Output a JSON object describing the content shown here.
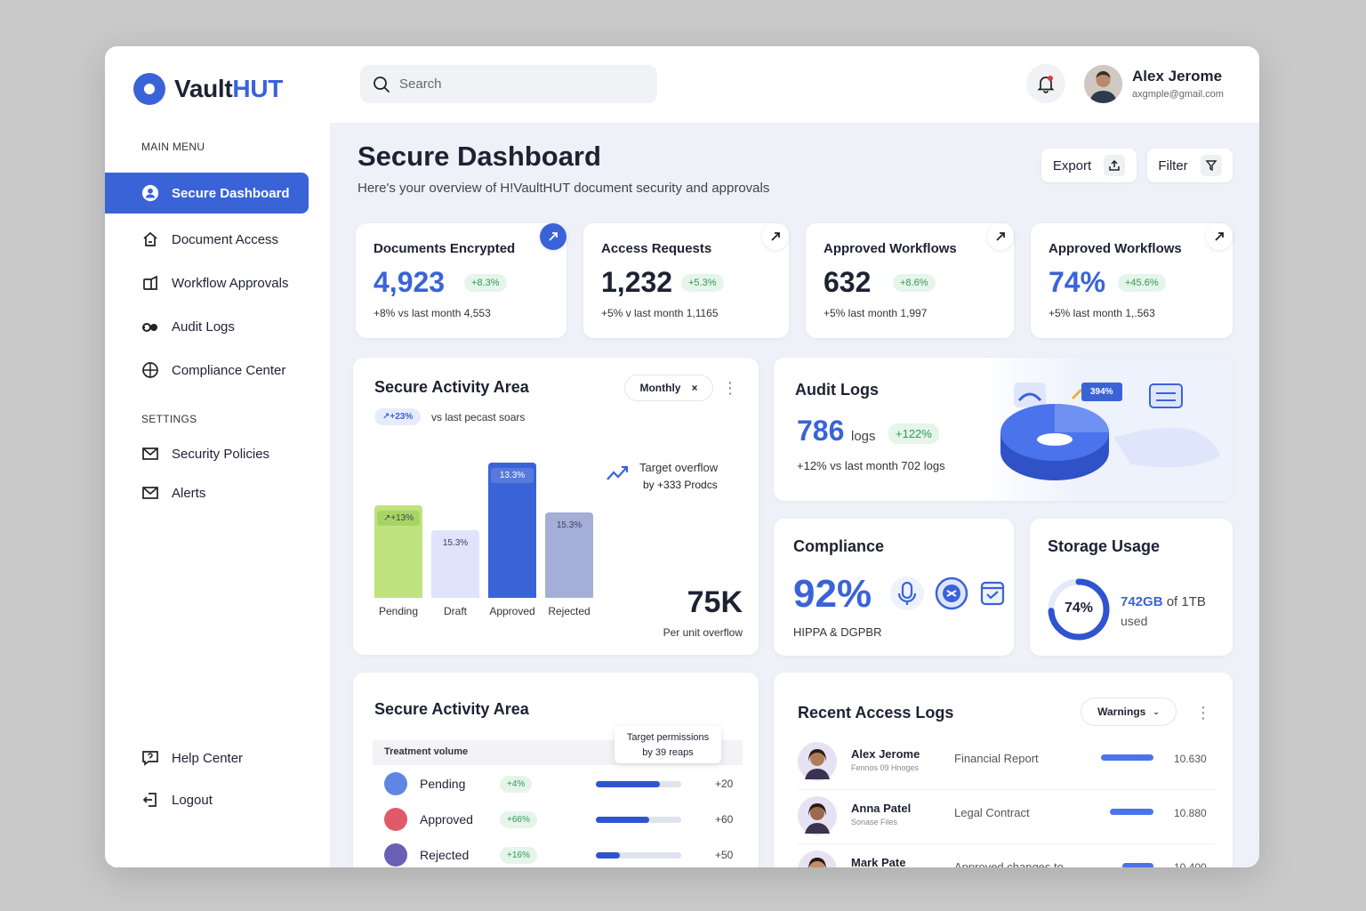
{
  "app": {
    "name_main": "Vault",
    "name_accent": "HUT"
  },
  "search": {
    "placeholder": "Search"
  },
  "user": {
    "name": "Alex Jerome",
    "email": "axgmple@gmail.com"
  },
  "menu": {
    "main_heading": "MAIN MENU",
    "settings_heading": "SETTINGS",
    "items": [
      {
        "label": "Secure Dashboard",
        "icon": "user-circle-icon"
      },
      {
        "label": "Document Access",
        "icon": "document-access-icon"
      },
      {
        "label": "Workflow Approvals",
        "icon": "workflow-icon"
      },
      {
        "label": "Audit Logs",
        "icon": "audit-icon"
      },
      {
        "label": "Compliance Center",
        "icon": "globe-icon"
      }
    ],
    "settings_items": [
      {
        "label": "Security Policies",
        "icon": "mail-icon"
      },
      {
        "label": "Alerts",
        "icon": "mail-icon"
      }
    ],
    "bottom_items": [
      {
        "label": "Help Center",
        "icon": "help-icon"
      },
      {
        "label": "Logout",
        "icon": "logout-icon"
      }
    ]
  },
  "page": {
    "title": "Secure Dashboard",
    "subtitle": "Here's your overview of H!VaultHUT document security and approvals",
    "export_label": "Export",
    "filter_label": "Filter"
  },
  "stats": [
    {
      "title": "Documents Encrypted",
      "value": "4,923",
      "change": "+8.3%",
      "foot": "+8% vs last month 4,553"
    },
    {
      "title": "Access Requests",
      "value": "1,232",
      "change": "+5.3%",
      "foot": "+5% v last month 1,1165"
    },
    {
      "title": "Approved Workflows",
      "value": "632",
      "change": "+8.6%",
      "foot": "+5% last month 1,997"
    },
    {
      "title": "Approved Workflows",
      "value": "74%",
      "change": "+45.6%",
      "foot": "+5% last month 1,.563"
    }
  ],
  "activity": {
    "title": "Secure Activity Area",
    "period": "Monthly",
    "change": "↗+23%",
    "change_note": "vs last pecast soars",
    "target_text_1": "Target overflow",
    "target_text_2": "by +333 Prodcs",
    "big_value": "75K",
    "big_label": "Per unit overflow"
  },
  "chart_data": {
    "type": "bar",
    "categories": [
      "Pending",
      "Draft",
      "Approved",
      "Rejected"
    ],
    "values": [
      26,
      19,
      38,
      24
    ],
    "data_labels": [
      "↗+13%",
      "15.3%",
      "13.3%",
      "15.3%"
    ],
    "colors": [
      "#bfe37e",
      "#dfe3fb",
      "#3a63d8",
      "#a4aed6"
    ],
    "ylim": [
      0,
      40
    ]
  },
  "audit": {
    "title": "Audit Logs",
    "value": "786",
    "unit": "logs",
    "change": "+122%",
    "foot": "+12% vs last month 702 logs",
    "badge": "394%"
  },
  "compliance": {
    "title": "Compliance",
    "value": "92%",
    "foot": "HIPPA & DGPBR"
  },
  "storage": {
    "title": "Storage Usage",
    "percent": "74%",
    "percent_value": 74,
    "used": "742GB",
    "total": "of 1TB",
    "used_label": "used"
  },
  "activity2": {
    "title": "Secure Activity Area",
    "header": "Treatment volume",
    "tooltip_1": "Target permissions",
    "tooltip_2": "by 39 reaps",
    "rows": [
      {
        "label": "Pending",
        "change": "+4%",
        "progress": 0.75,
        "value": "+20",
        "color": "#5f86e3"
      },
      {
        "label": "Approved",
        "change": "+66%",
        "progress": 0.62,
        "value": "+60",
        "color": "#e05a6a"
      },
      {
        "label": "Rejected",
        "change": "+16%",
        "progress": 0.28,
        "value": "+50",
        "color": "#6b5fb5"
      }
    ]
  },
  "recent": {
    "title": "Recent Access Logs",
    "filter": "Warnings",
    "rows": [
      {
        "name": "Alex Jerome",
        "sub": "Fennos 09 Hnoges",
        "doc": "Financial Report",
        "progress": 0.85,
        "value": "10.630"
      },
      {
        "name": "Anna Patel",
        "sub": "Sonase Files",
        "doc": "Legal Contract",
        "progress": 0.7,
        "value": "10.880"
      },
      {
        "name": "Mark Pate",
        "sub": "",
        "doc": "Approved changes to",
        "progress": 0.5,
        "value": "10.400"
      }
    ]
  }
}
